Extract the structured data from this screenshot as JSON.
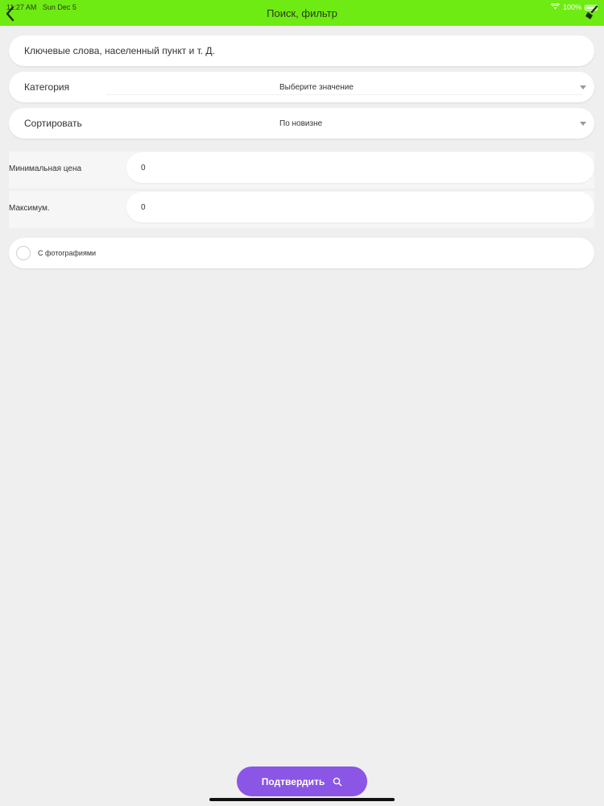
{
  "status": {
    "time": "11:27 AM",
    "date": "Sun Dec 5",
    "battery": "100%"
  },
  "nav": {
    "title": "Поиск, фильтр"
  },
  "keywords": {
    "placeholder": "Ключевые слова, населенный пункт и т. Д.",
    "value": ""
  },
  "category": {
    "label": "Категория",
    "value": "Выберите значение"
  },
  "sort": {
    "label": "Сортировать",
    "value": "По новизне"
  },
  "price_min": {
    "label": "Минимальная цена",
    "value": "0"
  },
  "price_max": {
    "label": "Максимум.",
    "value": "0"
  },
  "photos": {
    "label": "С фотографиями",
    "checked": false
  },
  "confirm": {
    "label": "Подтвердить"
  },
  "colors": {
    "accent": "#6eeb12",
    "button": "#8b55e6",
    "background": "#efeff0"
  },
  "icons": [
    "back-icon",
    "broom-icon",
    "wifi-icon",
    "battery-icon",
    "caret-down-icon",
    "search-icon"
  ]
}
